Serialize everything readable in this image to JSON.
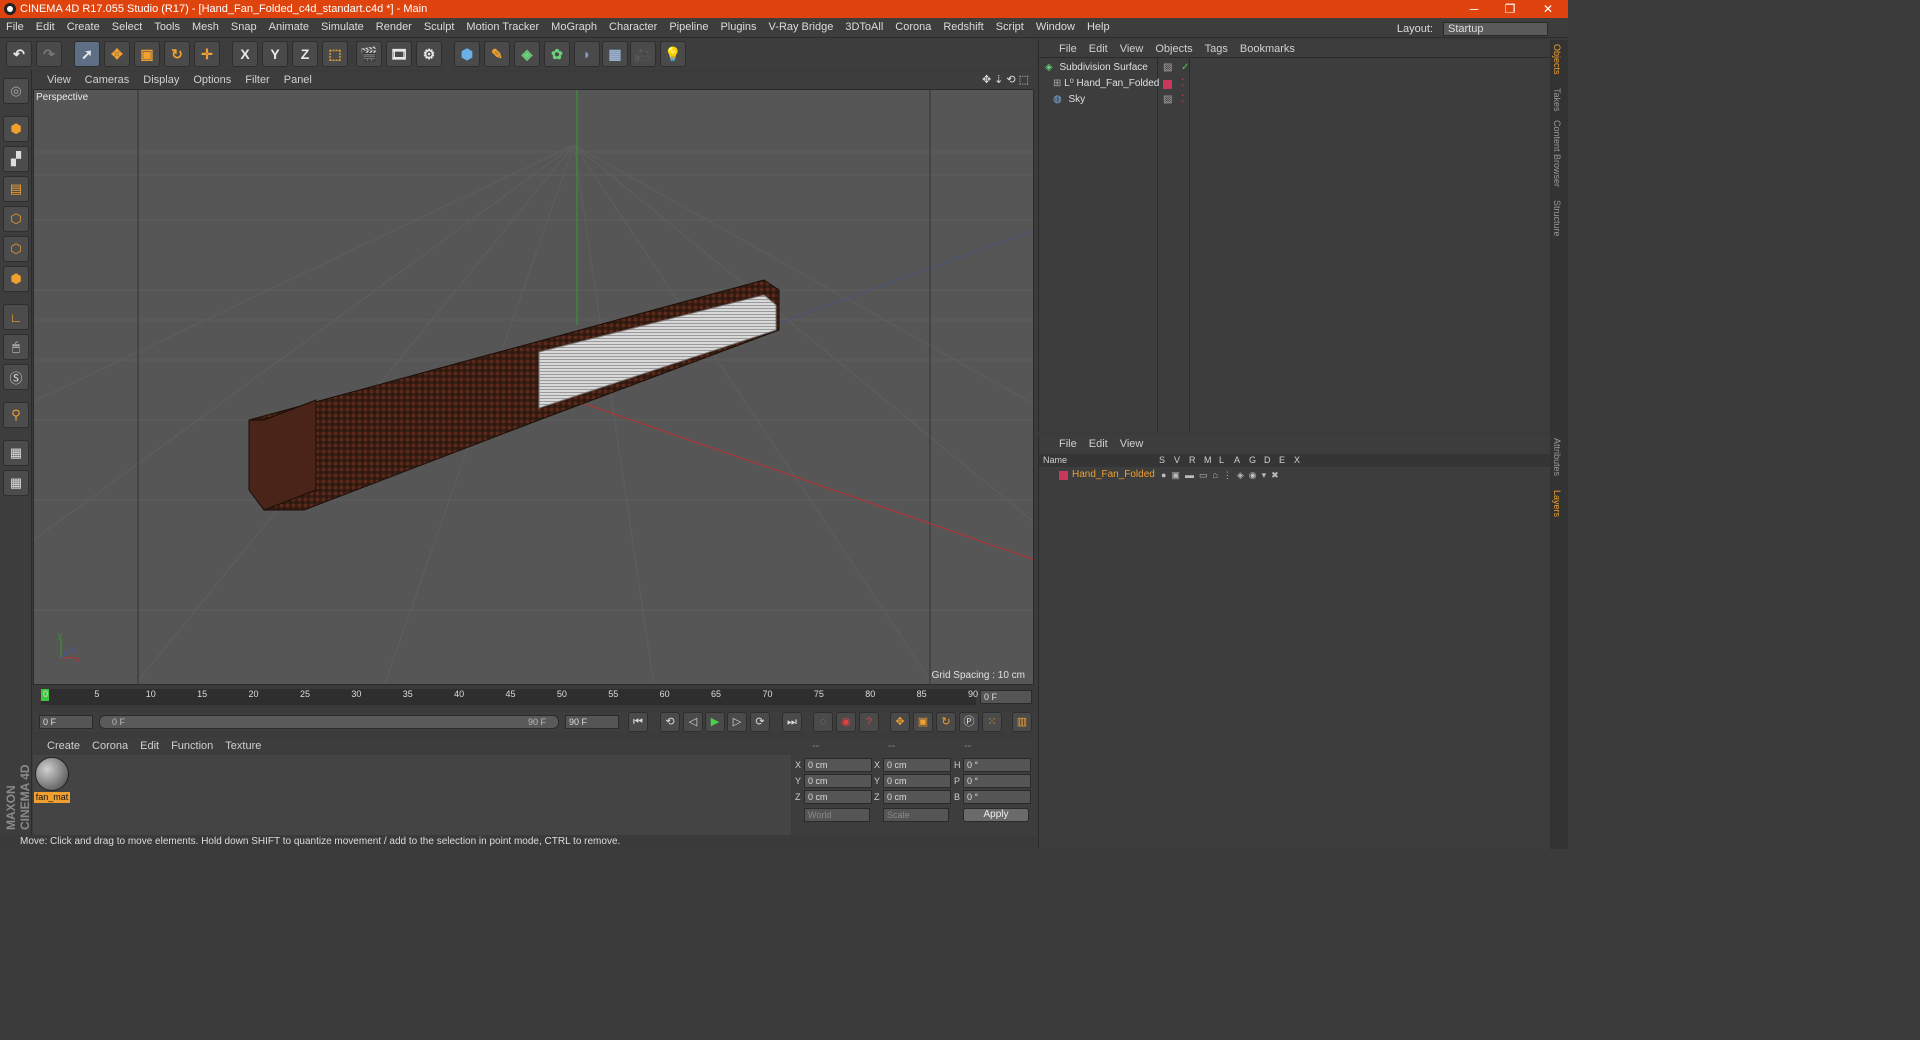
{
  "window": {
    "title": "CINEMA 4D R17.055 Studio (R17) - [Hand_Fan_Folded_c4d_standart.c4d *] - Main",
    "minimize": "─",
    "restore": "❐",
    "close": "✕"
  },
  "menubar": {
    "items": [
      "File",
      "Edit",
      "Create",
      "Select",
      "Tools",
      "Mesh",
      "Snap",
      "Animate",
      "Simulate",
      "Render",
      "Sculpt",
      "Motion Tracker",
      "MoGraph",
      "Character",
      "Pipeline",
      "Plugins",
      "V-Ray Bridge",
      "3DToAll",
      "Corona",
      "Redshift",
      "Script",
      "Window",
      "Help"
    ],
    "layout_label": "Layout:",
    "layout_value": "Startup"
  },
  "toolbar": {
    "axis_x": "X",
    "axis_y": "Y",
    "axis_z": "Z"
  },
  "viewport": {
    "menu": [
      "View",
      "Cameras",
      "Display",
      "Options",
      "Filter",
      "Panel"
    ],
    "label": "Perspective",
    "grid_spacing": "Grid Spacing : 10 cm"
  },
  "timeline": {
    "ticks": [
      "0",
      "5",
      "10",
      "15",
      "20",
      "25",
      "30",
      "35",
      "40",
      "45",
      "50",
      "55",
      "60",
      "65",
      "70",
      "75",
      "80",
      "85",
      "90"
    ],
    "current_frame": "0 F",
    "start_frame": "0 F",
    "range_start": "0 F",
    "range_end": "90 F",
    "end_frame": "90 F"
  },
  "material_manager": {
    "menu": [
      "Create",
      "Corona",
      "Edit",
      "Function",
      "Texture"
    ],
    "material_name": "fan_mat"
  },
  "coordinates": {
    "header_1": "--",
    "header_2": "--",
    "header_3": "--",
    "rows": [
      {
        "a": "X",
        "av": "0 cm",
        "b": "X",
        "bv": "0 cm",
        "c": "H",
        "cv": "0 °"
      },
      {
        "a": "Y",
        "av": "0 cm",
        "b": "Y",
        "bv": "0 cm",
        "c": "P",
        "cv": "0 °"
      },
      {
        "a": "Z",
        "av": "0 cm",
        "b": "Z",
        "bv": "0 cm",
        "c": "B",
        "cv": "0 °"
      }
    ],
    "space": "World",
    "mode": "Scale",
    "apply": "Apply"
  },
  "status": "Move: Click and drag to move elements. Hold down SHIFT to quantize movement / add to the selection in point mode, CTRL to remove.",
  "object_manager": {
    "menu": [
      "File",
      "Edit",
      "View",
      "Objects",
      "Tags",
      "Bookmarks"
    ],
    "objects": [
      "Subdivision Surface",
      "Hand_Fan_Folded",
      "Sky"
    ]
  },
  "layer_manager": {
    "menu": [
      "File",
      "Edit",
      "View"
    ],
    "name_header": "Name",
    "columns": [
      "S",
      "V",
      "R",
      "M",
      "L",
      "A",
      "G",
      "D",
      "E",
      "X"
    ],
    "layer_name": "Hand_Fan_Folded",
    "layer_color": "#c8385a"
  },
  "side_tabs": [
    "Objects",
    "Takes",
    "Content Browser",
    "Structure",
    "Attributes",
    "Layers"
  ],
  "brand": "MAXON CINEMA 4D"
}
